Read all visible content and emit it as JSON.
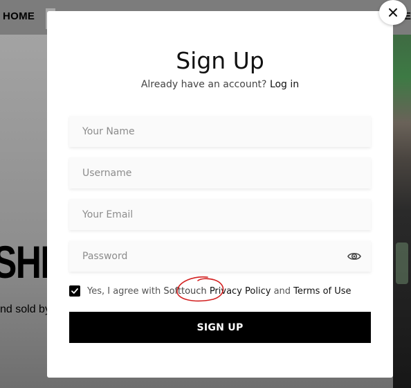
{
  "background": {
    "nav_home": "HOME",
    "nav_edge_letter": "E",
    "hero_headline": "SHII",
    "hero_subline": "nd sold by"
  },
  "modal": {
    "title": "Sign Up",
    "login_prompt": "Already have an account?",
    "login_link": "Log in",
    "fields": {
      "name": {
        "placeholder": "Your Name",
        "value": ""
      },
      "username": {
        "placeholder": "Username",
        "value": ""
      },
      "email": {
        "placeholder": "Your Email",
        "value": ""
      },
      "password": {
        "placeholder": "Password",
        "value": ""
      }
    },
    "agree": {
      "checked": true,
      "prefix": "Yes, I agree with",
      "brand": "Softtouch",
      "privacy_link": "Privacy Policy",
      "and": "and",
      "terms_link": "Terms of Use"
    },
    "submit_label": "SIGN UP",
    "annotation_color": "#d32020"
  },
  "icons": {
    "close": "close-icon",
    "password_toggle": "eye-icon",
    "checkbox": "checkmark-icon"
  }
}
